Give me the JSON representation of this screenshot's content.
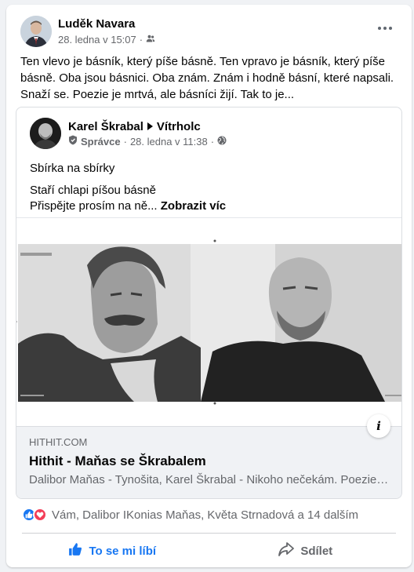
{
  "post": {
    "author": "Luděk Navara",
    "time": "28. ledna v 15:07",
    "separator": "·",
    "audience_icon": "friends-icon",
    "text_lines": [
      "Ten vlevo je básník, který píše básně. Ten vpravo je básník, který píše",
      "básně. Oba jsou básnici. Oba znám. Znám i hodně básní, které napsali.",
      "Snaží se. Poezie je mrtvá, ale básníci žijí. Tak to je..."
    ]
  },
  "shared": {
    "author": "Karel Škrabal",
    "group": "Vítrholc",
    "role": "Správce",
    "separator": "·",
    "time": "28. ledna v 11:38",
    "audience_icon": "globe-icon",
    "line1": "Sbírka na sbírky",
    "line2": "Staří chlapi píšou básně",
    "line3": "Přispějte prosím na ně...",
    "see_more": "Zobrazit víc",
    "image_caption_left": "Maňas & Škrabal",
    "image_footer_left": "www.hithit.com",
    "image_footer_right": "Hithit"
  },
  "link": {
    "domain": "HITHIT.COM",
    "title": "Hithit - Maňas se Škrabalem",
    "description": "Dalibor Maňas - Tynošita, Karel Škrabal - Nikoho nečekám. Poezie. Ni..."
  },
  "reactions": {
    "summary": "Vám, Dalibor IKonias Maňas, Květa Strnadová a 14 dalším"
  },
  "actions": {
    "like_label": "To se mi líbí",
    "share_label": "Sdílet"
  },
  "colors": {
    "accent": "#1877f2",
    "love": "#f33e58",
    "secondary_text": "#65676b"
  }
}
